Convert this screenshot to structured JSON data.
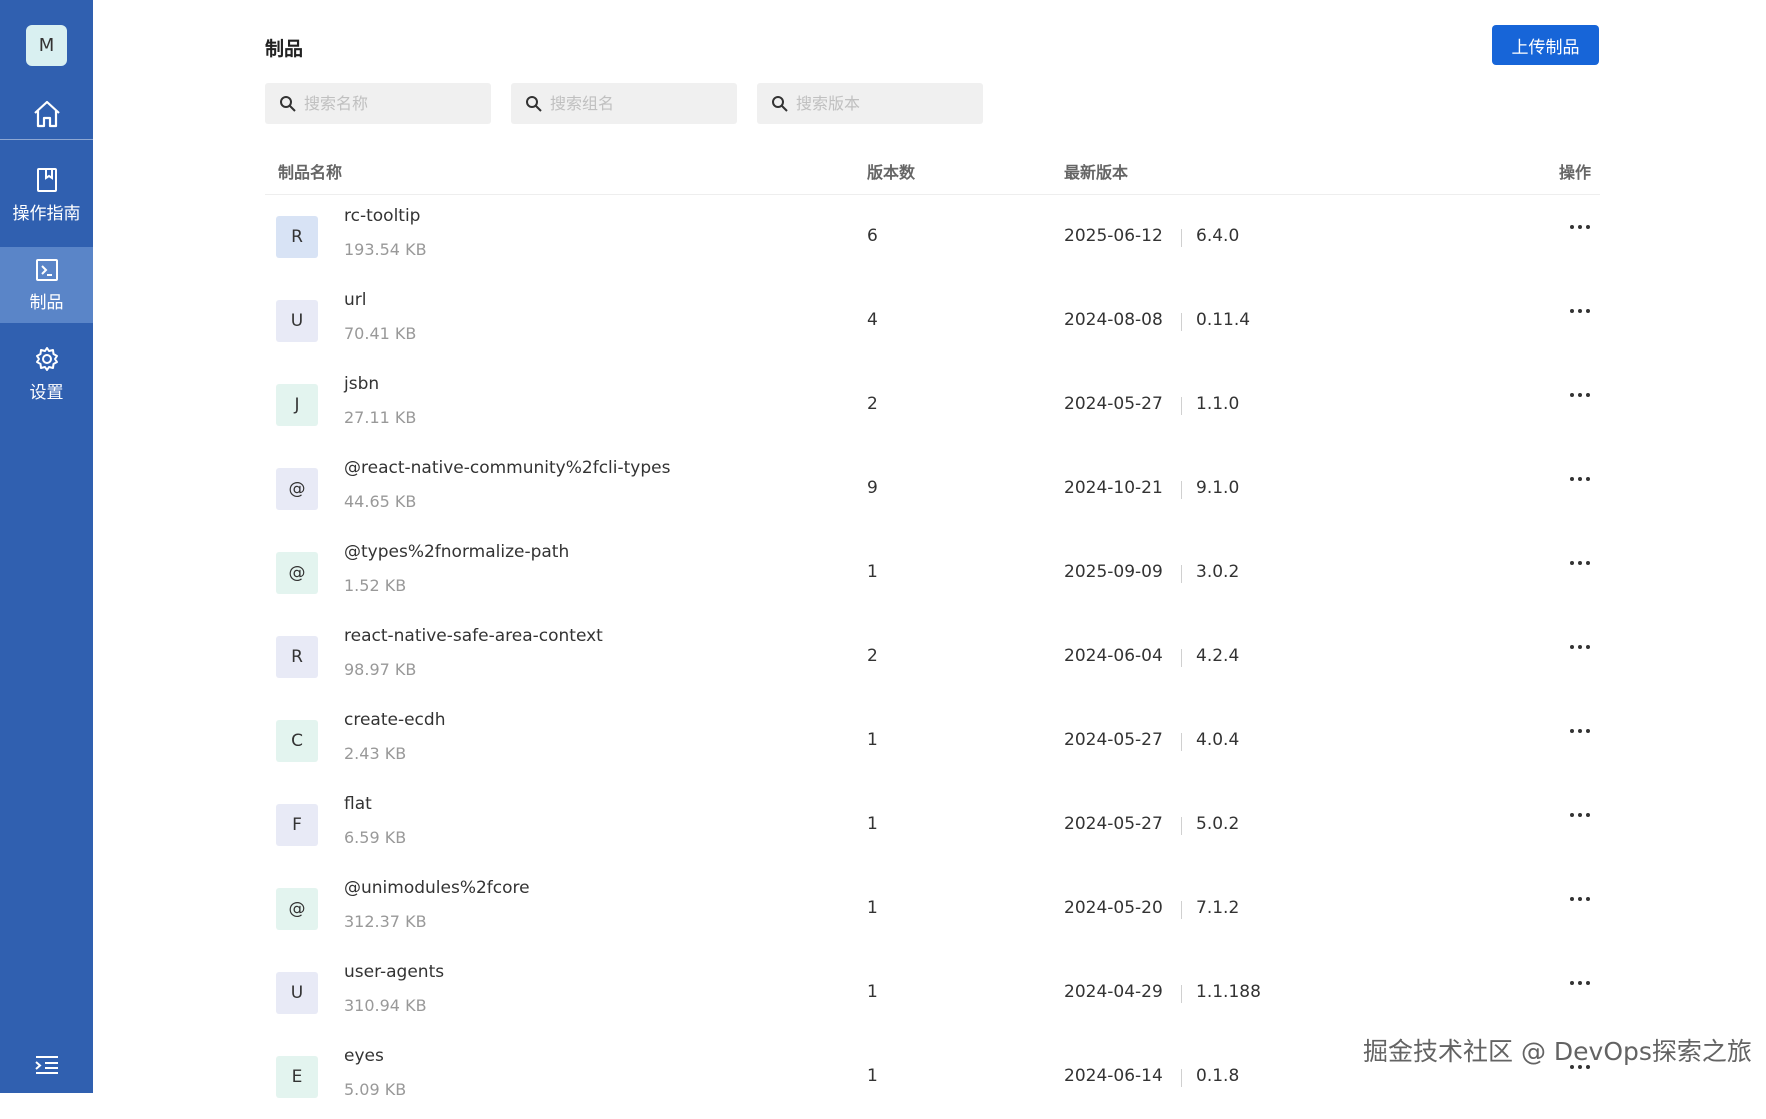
{
  "sidebar": {
    "avatar_letter": "M",
    "home_icon": "home-icon",
    "items": [
      {
        "label": "操作指南",
        "icon": "book-icon"
      },
      {
        "label": "制品",
        "icon": "terminal-icon"
      },
      {
        "label": "设置",
        "icon": "gear-icon"
      }
    ],
    "collapse_icon": "menu-collapse-icon"
  },
  "header": {
    "title": "制品",
    "upload_label": "上传制品"
  },
  "search": {
    "name_placeholder": "搜索名称",
    "group_placeholder": "搜索组名",
    "version_placeholder": "搜索版本"
  },
  "table": {
    "headers": {
      "name": "制品名称",
      "count": "版本数",
      "latest": "最新版本",
      "actions": "操作"
    },
    "rows": [
      {
        "letter": "R",
        "avatar_color": "#d8e3f5",
        "name": "rc-tooltip",
        "size": "193.54 KB",
        "count": "6",
        "date": "2025-06-12",
        "version": "6.4.0"
      },
      {
        "letter": "U",
        "avatar_color": "#e8eaf6",
        "name": "url",
        "size": "70.41 KB",
        "count": "4",
        "date": "2024-08-08",
        "version": "0.11.4"
      },
      {
        "letter": "J",
        "avatar_color": "#e3f4ef",
        "name": "jsbn",
        "size": "27.11 KB",
        "count": "2",
        "date": "2024-05-27",
        "version": "1.1.0"
      },
      {
        "letter": "@",
        "avatar_color": "#e8eaf6",
        "name": "@react-native-community%2fcli-types",
        "size": "44.65 KB",
        "count": "9",
        "date": "2024-10-21",
        "version": "9.1.0"
      },
      {
        "letter": "@",
        "avatar_color": "#e3f4ef",
        "name": "@types%2fnormalize-path",
        "size": "1.52 KB",
        "count": "1",
        "date": "2025-09-09",
        "version": "3.0.2"
      },
      {
        "letter": "R",
        "avatar_color": "#e8eaf6",
        "name": "react-native-safe-area-context",
        "size": "98.97 KB",
        "count": "2",
        "date": "2024-06-04",
        "version": "4.2.4"
      },
      {
        "letter": "C",
        "avatar_color": "#e3f4ef",
        "name": "create-ecdh",
        "size": "2.43 KB",
        "count": "1",
        "date": "2024-05-27",
        "version": "4.0.4"
      },
      {
        "letter": "F",
        "avatar_color": "#e8eaf6",
        "name": "flat",
        "size": "6.59 KB",
        "count": "1",
        "date": "2024-05-27",
        "version": "5.0.2"
      },
      {
        "letter": "@",
        "avatar_color": "#e3f4ef",
        "name": "@unimodules%2fcore",
        "size": "312.37 KB",
        "count": "1",
        "date": "2024-05-20",
        "version": "7.1.2"
      },
      {
        "letter": "U",
        "avatar_color": "#e8eaf6",
        "name": "user-agents",
        "size": "310.94 KB",
        "count": "1",
        "date": "2024-04-29",
        "version": "1.1.188"
      },
      {
        "letter": "E",
        "avatar_color": "#e3f4ef",
        "name": "eyes",
        "size": "5.09 KB",
        "count": "1",
        "date": "2024-06-14",
        "version": "0.1.8"
      }
    ]
  },
  "watermark": "掘金技术社区 @ DevOps探索之旅"
}
